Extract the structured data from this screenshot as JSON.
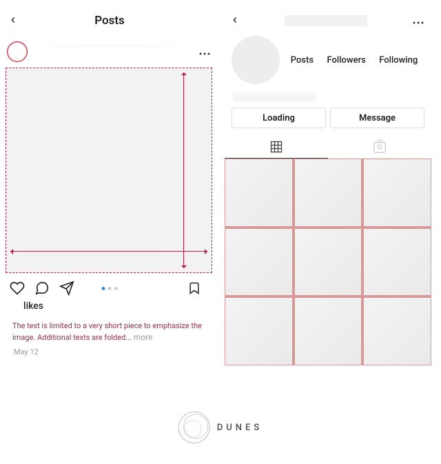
{
  "left": {
    "header_title": "Posts",
    "likes_label": "likes",
    "caption_text": "The text is limited to a very short piece to emphasize the image. Additional texts are folded...",
    "more_label": "more",
    "date_label": "May 12"
  },
  "right": {
    "stats": {
      "posts": "Posts",
      "followers": "Followers",
      "following": "Following"
    },
    "buttons": {
      "loading": "Loading",
      "message": "Message"
    }
  },
  "brand": {
    "name": "DUNES"
  }
}
